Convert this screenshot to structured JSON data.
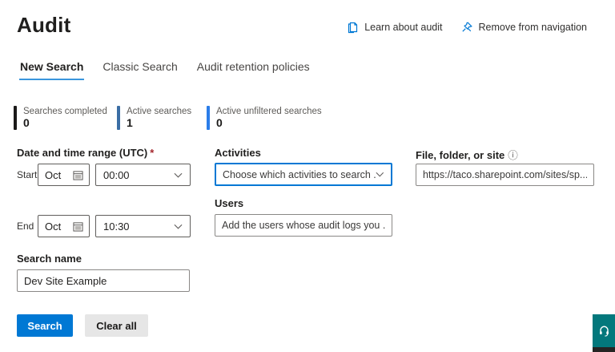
{
  "title": "Audit",
  "header_links": [
    {
      "label": "Learn about audit",
      "icon": "book-icon"
    },
    {
      "label": "Remove from navigation",
      "icon": "unpin-icon"
    }
  ],
  "tabs": [
    {
      "label": "New Search",
      "active": true
    },
    {
      "label": "Classic Search",
      "active": false
    },
    {
      "label": "Audit retention policies",
      "active": false
    }
  ],
  "stats": [
    {
      "label": "Searches completed",
      "value": "0",
      "bar_color": "#1b1a19"
    },
    {
      "label": "Active searches",
      "value": "1",
      "bar_color": "#3b6ea5"
    },
    {
      "label": "Active unfiltered searches",
      "value": "0",
      "bar_color": "#2b7de9"
    }
  ],
  "form": {
    "date_time_label": "Date and time range (UTC)",
    "required_marker": "*",
    "info_glyph": "ⓘ",
    "start_label": "Start",
    "end_label": "End",
    "start_date": "Oct",
    "start_time": "00:00",
    "end_date": "Oct",
    "end_time": "10:30",
    "activities_label": "Activities",
    "activities_value": "Choose which activities to search ...",
    "file_label": "File, folder, or site",
    "file_value": "https://taco.sharepoint.com/sites/sp...",
    "users_label": "Users",
    "users_value": "Add the users whose audit logs you ...",
    "search_name_label": "Search name",
    "search_name_value": "Dev Site Example"
  },
  "buttons": {
    "search": "Search",
    "clear": "Clear all"
  },
  "colors": {
    "primary": "#0078d4",
    "tab_underline": "#3a96dd",
    "help_widget": "#03787c",
    "required": "#a4262c"
  }
}
